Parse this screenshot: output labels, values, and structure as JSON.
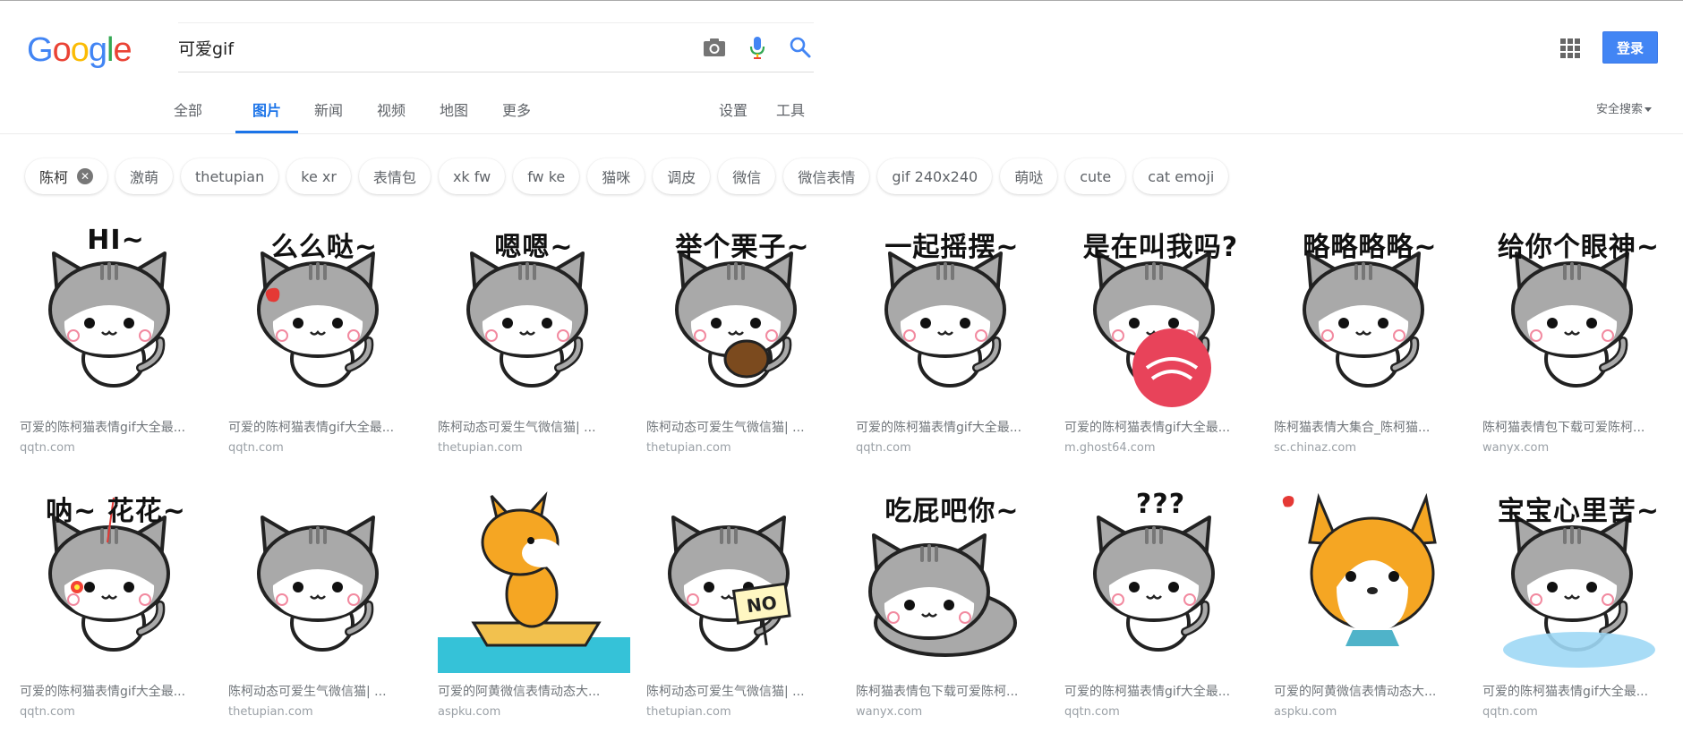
{
  "header": {
    "search_value": "可爱gif",
    "signin_label": "登录"
  },
  "tabs": [
    {
      "label": "全部"
    },
    {
      "label": "图片"
    },
    {
      "label": "新闻"
    },
    {
      "label": "视频"
    },
    {
      "label": "地图"
    },
    {
      "label": "更多"
    }
  ],
  "tools": {
    "settings": "设置",
    "tools": "工具"
  },
  "safe_search": "安全搜索",
  "chips": [
    {
      "label": "陈柯"
    },
    {
      "label": "激萌"
    },
    {
      "label": "thetupian"
    },
    {
      "label": "ke xr"
    },
    {
      "label": "表情包"
    },
    {
      "label": "xk fw"
    },
    {
      "label": "fw ke"
    },
    {
      "label": "猫咪"
    },
    {
      "label": "调皮"
    },
    {
      "label": "微信"
    },
    {
      "label": "微信表情"
    },
    {
      "label": "gif 240x240"
    },
    {
      "label": "萌哒"
    },
    {
      "label": "cute"
    },
    {
      "label": "cat emoji"
    }
  ],
  "results": [
    {
      "caption": "可爱的陈柯猫表情gif大全最...",
      "source": "qqtn.com",
      "overlay": "HI~"
    },
    {
      "caption": "可爱的陈柯猫表情gif大全最...",
      "source": "qqtn.com",
      "overlay": "么么哒~"
    },
    {
      "caption": "陈柯动态可爱生气微信猫| ...",
      "source": "thetupian.com",
      "overlay": "嗯嗯~"
    },
    {
      "caption": "陈柯动态可爱生气微信猫| ...",
      "source": "thetupian.com",
      "overlay": "举个栗子~"
    },
    {
      "caption": "可爱的陈柯猫表情gif大全最...",
      "source": "qqtn.com",
      "overlay": "一起摇摆~"
    },
    {
      "caption": "可爱的陈柯猫表情gif大全最...",
      "source": "m.ghost64.com",
      "overlay": "是在叫我吗?"
    },
    {
      "caption": "陈柯猫表情大集合_陈柯猫...",
      "source": "sc.chinaz.com",
      "overlay": "略略略略~"
    },
    {
      "caption": "陈柯猫表情包下载可爱陈柯...",
      "source": "wanyx.com",
      "overlay": "给你个眼神~"
    },
    {
      "caption": "可爱的陈柯猫表情gif大全最...",
      "source": "qqtn.com",
      "overlay": "呐~ 花花~"
    },
    {
      "caption": "陈柯动态可爱生气微信猫| ...",
      "source": "thetupian.com",
      "overlay": ""
    },
    {
      "caption": "可爱的阿黄微信表情动态大...",
      "source": "aspku.com",
      "overlay": ""
    },
    {
      "caption": "陈柯动态可爱生气微信猫| ...",
      "source": "thetupian.com",
      "overlay": ""
    },
    {
      "caption": "陈柯猫表情包下载可爱陈柯...",
      "source": "wanyx.com",
      "overlay": "吃屁吧你~"
    },
    {
      "caption": "可爱的陈柯猫表情gif大全最...",
      "source": "qqtn.com",
      "overlay": "???"
    },
    {
      "caption": "可爱的阿黄微信表情动态大...",
      "source": "aspku.com",
      "overlay": ""
    },
    {
      "caption": "可爱的陈柯猫表情gif大全最...",
      "source": "qqtn.com",
      "overlay": "宝宝心里苦~"
    }
  ],
  "badge_text": "NO",
  "colors": {
    "accent": "#1a73e8",
    "signin_bg": "#4285f4",
    "cat_gray": "#a9a9a9",
    "dog_orange": "#f5a623"
  }
}
